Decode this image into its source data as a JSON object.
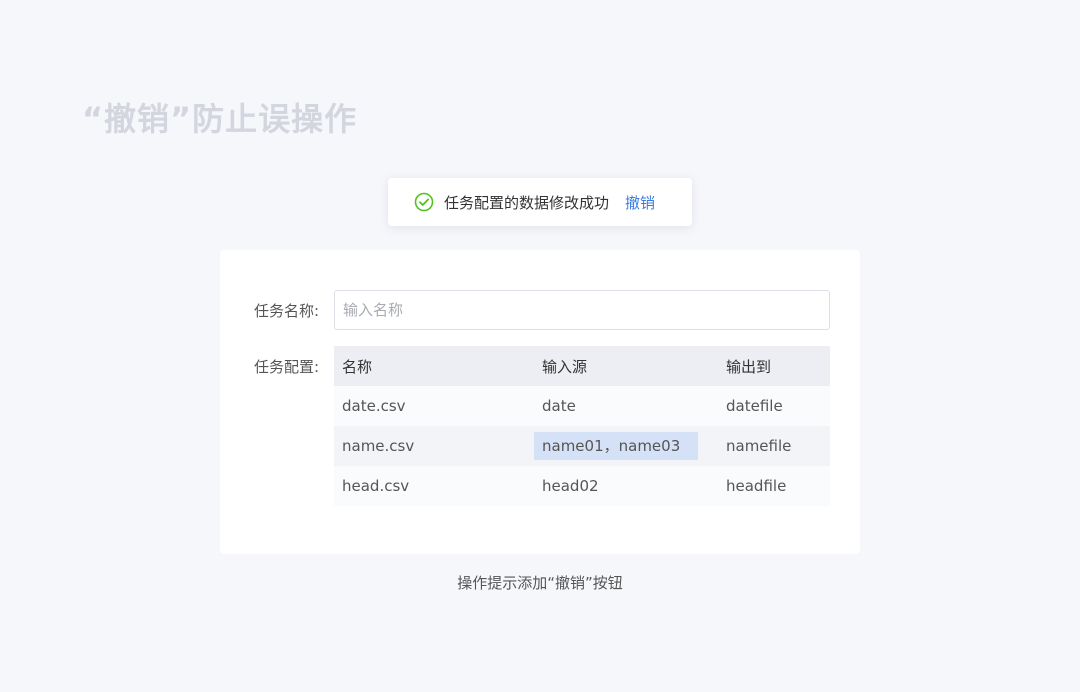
{
  "page": {
    "heading": "“撤销”防止误操作",
    "caption": "操作提示添加“撤销”按钮"
  },
  "toast": {
    "icon": "check-circle-icon",
    "message": "任务配置的数据修改成功",
    "undo_label": "撤销",
    "colors": {
      "success": "#52c41a",
      "link": "#3a7ce0"
    }
  },
  "form": {
    "name_label": "任务名称:",
    "name_placeholder": "输入名称",
    "name_value": "",
    "config_label": "任务配置:"
  },
  "table": {
    "headers": [
      "名称",
      "输入源",
      "输出到"
    ],
    "rows": [
      [
        "date.csv",
        "date",
        "datefile"
      ],
      [
        "name.csv",
        "name01，name03",
        "namefile"
      ],
      [
        "head.csv",
        "head02",
        "headfile"
      ]
    ],
    "highlighted_cell": {
      "row": 1,
      "col": 1,
      "color": "#d4e1f7"
    }
  }
}
